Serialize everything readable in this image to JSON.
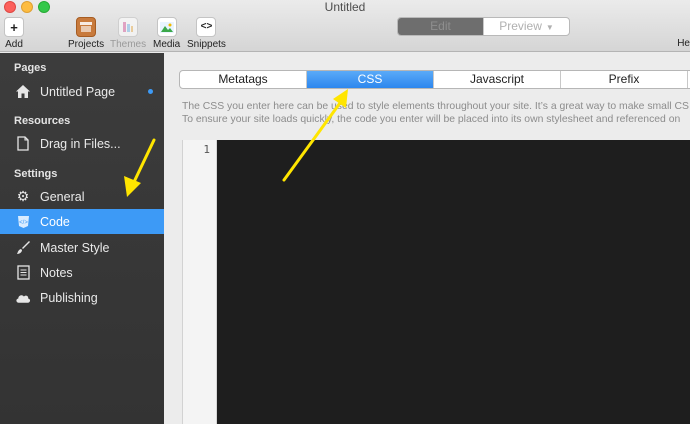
{
  "window": {
    "title": "Untitled"
  },
  "toolbar": {
    "add": "Add",
    "projects": "Projects",
    "themes": "Themes",
    "media": "Media",
    "snippets": "Snippets",
    "edit": "Edit",
    "preview": "Preview",
    "help_partial": "He"
  },
  "sidebar": {
    "pages_header": "Pages",
    "page_item": "Untitled Page",
    "resources_header": "Resources",
    "resources_item": "Drag in Files...",
    "settings_header": "Settings",
    "settings_items": [
      "General",
      "Code",
      "Master Style",
      "Notes",
      "Publishing"
    ],
    "active_item": "Code"
  },
  "main": {
    "tabs": [
      "Metatags",
      "CSS",
      "Javascript",
      "Prefix"
    ],
    "active_tab": "CSS",
    "description_line1": "The CSS you enter here can be used to style elements throughout your site. It’s a great way to make small CS",
    "description_line2": "To ensure your site loads quickly, the code you enter will be placed into its own stylesheet and referenced on",
    "line_number": "1"
  },
  "colors": {
    "accent": "#3d9af6",
    "annotation_arrow": "#ffe500"
  }
}
